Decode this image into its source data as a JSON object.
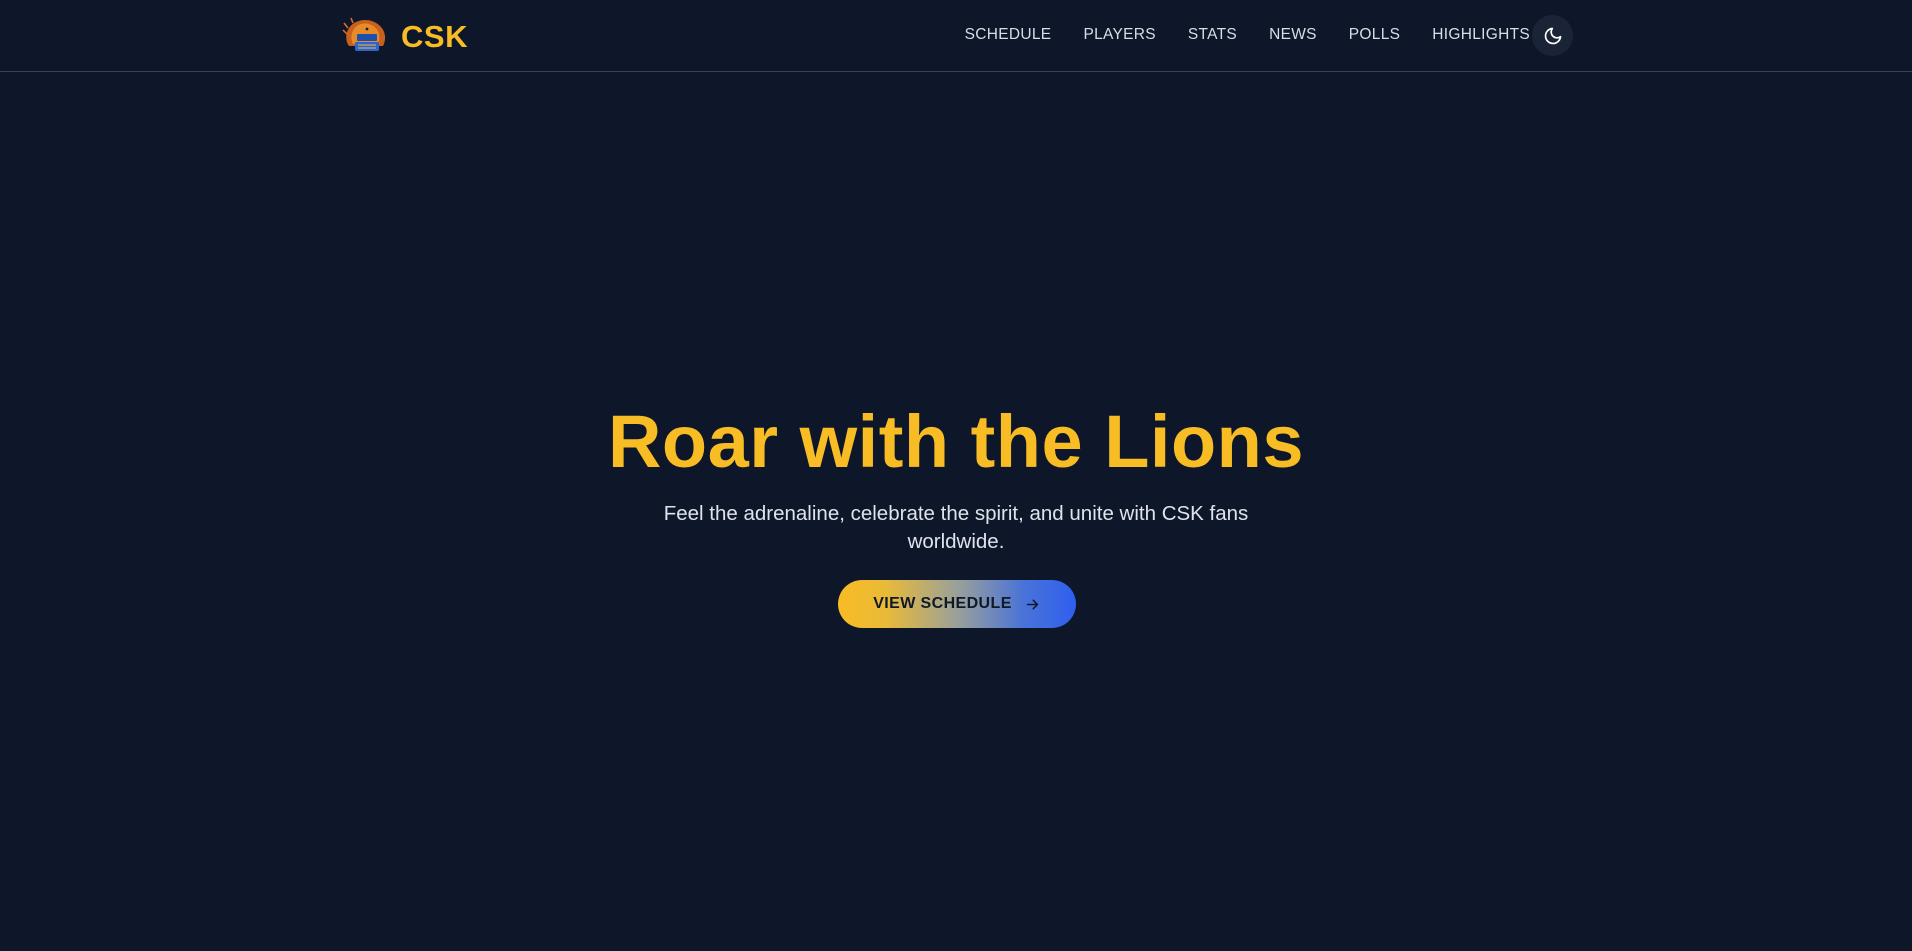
{
  "brand": {
    "logo_icon": "csk-lion-logo",
    "name": "CSK"
  },
  "nav": {
    "items": [
      {
        "label": "SCHEDULE"
      },
      {
        "label": "PLAYERS"
      },
      {
        "label": "STATS"
      },
      {
        "label": "NEWS"
      },
      {
        "label": "POLLS"
      },
      {
        "label": "HIGHLIGHTS"
      }
    ],
    "theme_toggle_icon": "moon-icon"
  },
  "hero": {
    "title": "Roar with the Lions",
    "subtitle": "Feel the adrenaline, celebrate the spirit, and unite with CSK fans worldwide.",
    "cta_label": "VIEW SCHEDULE",
    "cta_icon": "arrow-right-icon"
  },
  "colors": {
    "background": "#0e1729",
    "accent": "#f8bc24",
    "gradient_end": "#2e5fef",
    "nav_text": "#d9dde6"
  }
}
